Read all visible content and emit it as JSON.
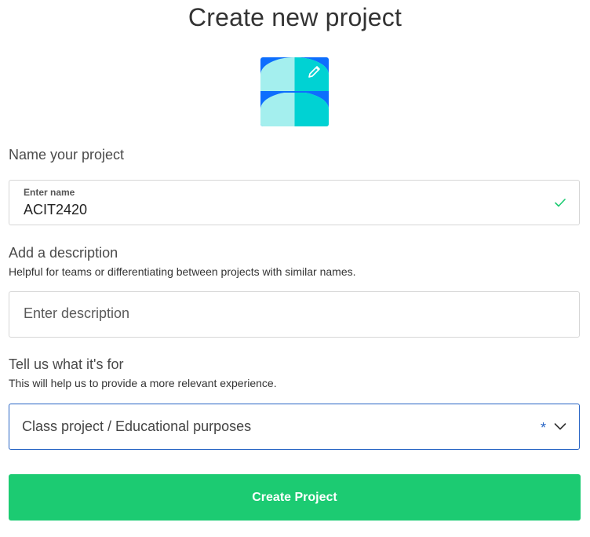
{
  "page": {
    "title": "Create new project"
  },
  "avatar": {
    "icon": "pencil-icon",
    "colors": {
      "background": "#0d6efd",
      "shape_light": "#a4efee",
      "shape_dark": "#00d2d3"
    }
  },
  "name_section": {
    "heading": "Name your project",
    "field_label": "Enter name",
    "value": "ACIT2420",
    "valid_icon": "check-icon"
  },
  "description_section": {
    "heading": "Add a description",
    "subtext": "Helpful for teams or differentiating between projects with similar names.",
    "placeholder": "Enter description",
    "value": ""
  },
  "purpose_section": {
    "heading": "Tell us what it's for",
    "subtext": "This will help us to provide a more relevant experience.",
    "selected": "Class project / Educational purposes",
    "required_marker": "*",
    "dropdown_icon": "chevron-down-icon"
  },
  "actions": {
    "create_label": "Create Project"
  },
  "colors": {
    "accent": "#1ccb72",
    "focus": "#2a66c5",
    "check": "#1ccb72"
  }
}
